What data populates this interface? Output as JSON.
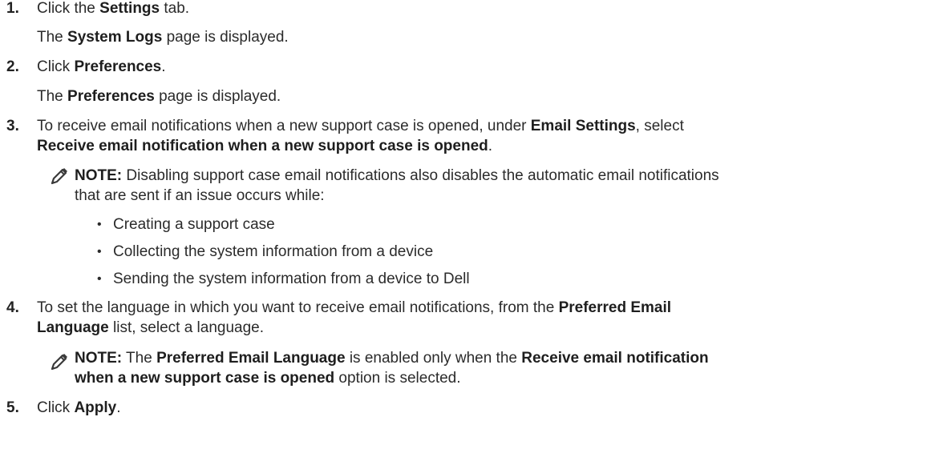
{
  "steps": [
    {
      "num": "1.",
      "a": "Click the ",
      "b": "Settings",
      "c": " tab.",
      "result": {
        "a": "The ",
        "b": "System Logs",
        "c": " page is displayed."
      }
    },
    {
      "num": "2.",
      "a": "Click ",
      "b": "Preferences",
      "c": ".",
      "result": {
        "a": "The ",
        "b": "Preferences",
        "c": " page is displayed."
      }
    },
    {
      "num": "3.",
      "a": "To receive email notifications when a new support case is opened, under ",
      "b": "Email Settings",
      "c": ", select",
      "d": "Receive email notification when a new support case is opened",
      "e": ".",
      "note": {
        "label": "NOTE:",
        "line1": " Disabling support case email notifications also disables the automatic email notifications",
        "line2": "that are sent if an issue occurs while:",
        "bullets": [
          "Creating a support case",
          "Collecting the system information from a device",
          "Sending the system information from a device to Dell"
        ]
      }
    },
    {
      "num": "4.",
      "a": "To set the language in which you want to receive email notifications, from the ",
      "b": "Preferred Email",
      "c": "Language",
      "d": " list, select a language.",
      "note": {
        "label": "NOTE:",
        "a": " The ",
        "b": "Preferred Email Language",
        "c": " is enabled only when the ",
        "d": "Receive email notification",
        "e": "when a new support case is opened",
        "f": " option is selected."
      }
    },
    {
      "num": "5.",
      "a": "Click ",
      "b": "Apply",
      "c": "."
    }
  ],
  "icons": {
    "note": "pencil-note-icon"
  },
  "colors": {
    "text": "#2b2b2b",
    "bold": "#1e1e1e",
    "icon": "#3a3a3a"
  }
}
